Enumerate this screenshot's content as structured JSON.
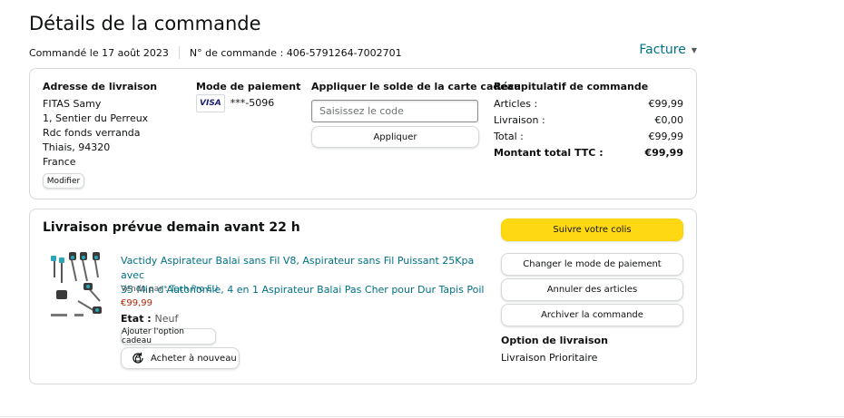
{
  "page": {
    "title": "Détails de la commande",
    "order_date": "Commandé le 17 août 2023",
    "order_number": "N° de commande : 406-5791264-7002701",
    "invoice": "Facture"
  },
  "shipping": {
    "heading": "Adresse de livraison",
    "name": "FITAS Samy",
    "line1": "1, Sentier du Perreux",
    "line2": "Rdc fonds verranda",
    "line3": "Thiais, 94320",
    "country": "France",
    "modify": "Modifier"
  },
  "payment": {
    "heading": "Mode de paiement",
    "card_brand": "VISA",
    "card_number": "***-5096"
  },
  "gift_card": {
    "heading": "Appliquer le solde de la carte cadeau",
    "placeholder": "Saisissez le code",
    "apply": "Appliquer"
  },
  "summary": {
    "heading": "Récapitulatif de commande",
    "rows": [
      {
        "label": "Articles :",
        "value": "€99,99"
      },
      {
        "label": "Livraison :",
        "value": "€0,00"
      },
      {
        "label": "Total :",
        "value": "€99,99"
      }
    ],
    "grand_label": "Montant total TTC :",
    "grand_value": "€99,99"
  },
  "delivery": {
    "heading": "Livraison prévue demain avant 22 h",
    "product_title_1": "Vactidy Aspirateur Balai sans Fil V8, Aspirateur sans Fil Puissant 25Kpa avec",
    "product_title_2": "35 Min d'Autonomie, 4 en 1 Aspirateur Balai Pas Cher pour Dur Tapis Poil",
    "sold_by_label": "Vendu par : ",
    "seller": "Tech Pro EU",
    "price": "€99,99",
    "state_label": "Etat : ",
    "state_value": "Neuf",
    "gift_option": "Ajouter l'option cadeau",
    "buy_again": "Acheter à nouveau"
  },
  "actions": {
    "track": "Suivre votre colis",
    "change_payment": "Changer le mode de paiement",
    "cancel": "Annuler des articles",
    "archive": "Archiver la commande",
    "shipping_option_heading": "Option de livraison",
    "shipping_option_value": "Livraison Prioritaire"
  },
  "colors": {
    "link": "#007185",
    "price": "#b12704",
    "primary_button": "#ffd814"
  }
}
